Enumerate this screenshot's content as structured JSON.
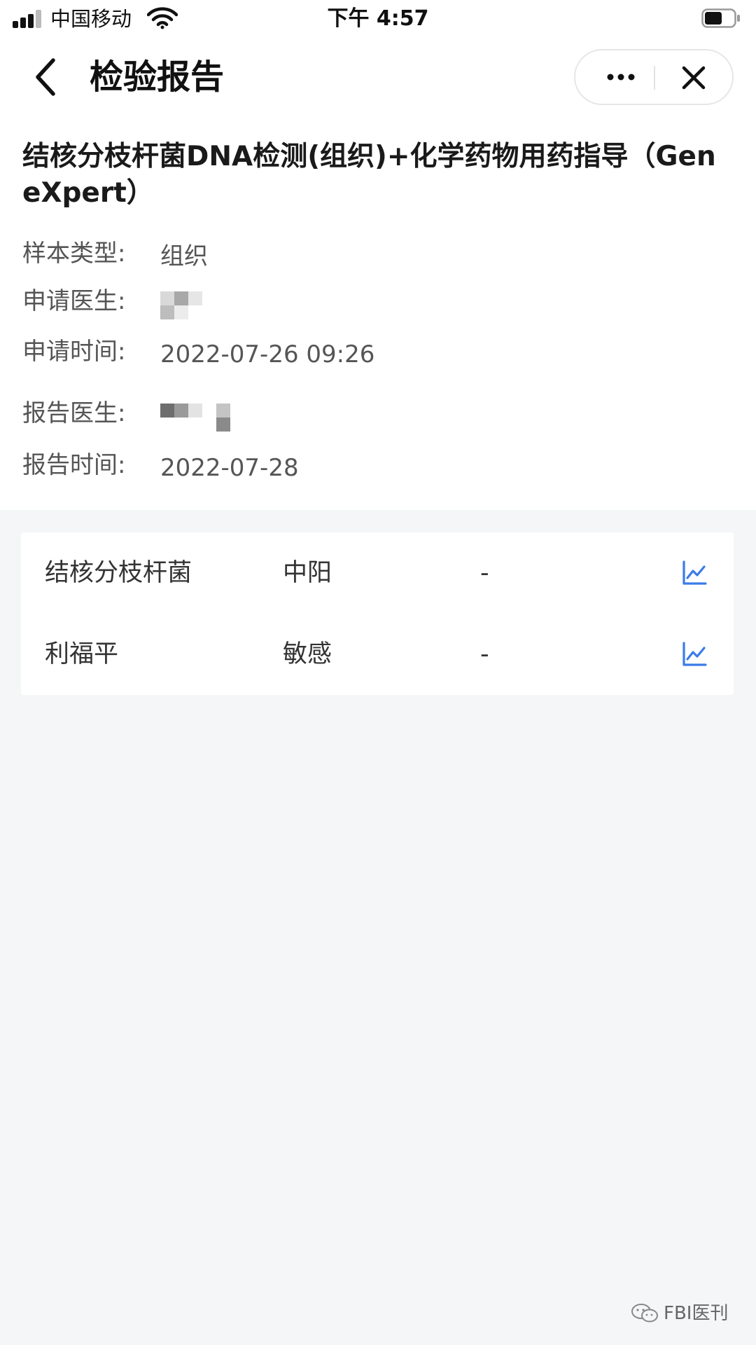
{
  "status_bar": {
    "carrier": "中国移动",
    "time": "下午 4:57"
  },
  "nav": {
    "title": "检验报告",
    "back_icon": "chevron-left-icon",
    "more_icon": "more-dots-icon",
    "close_icon": "close-icon"
  },
  "report": {
    "title": "结核分枝杆菌DNA检测(组织)+化学药物用药指导（GeneXpert）",
    "fields": [
      {
        "label": "样本类型:",
        "value": "组织"
      },
      {
        "label": "申请医生:",
        "value": ""
      },
      {
        "label": "申请时间:",
        "value": "2022-07-26 09:26"
      },
      {
        "label": "报告医生:",
        "value": ""
      },
      {
        "label": "报告时间:",
        "value": "2022-07-28"
      }
    ]
  },
  "results": [
    {
      "name": "结核分枝杆菌",
      "value": "中阳",
      "reference": "-",
      "icon": "trend-chart-icon"
    },
    {
      "name": "利福平",
      "value": "敏感",
      "reference": "-",
      "icon": "trend-chart-icon"
    }
  ],
  "colors": {
    "accent": "#3b7be8",
    "background": "#f5f6f8"
  },
  "watermark": {
    "text": "FBI医刊"
  }
}
